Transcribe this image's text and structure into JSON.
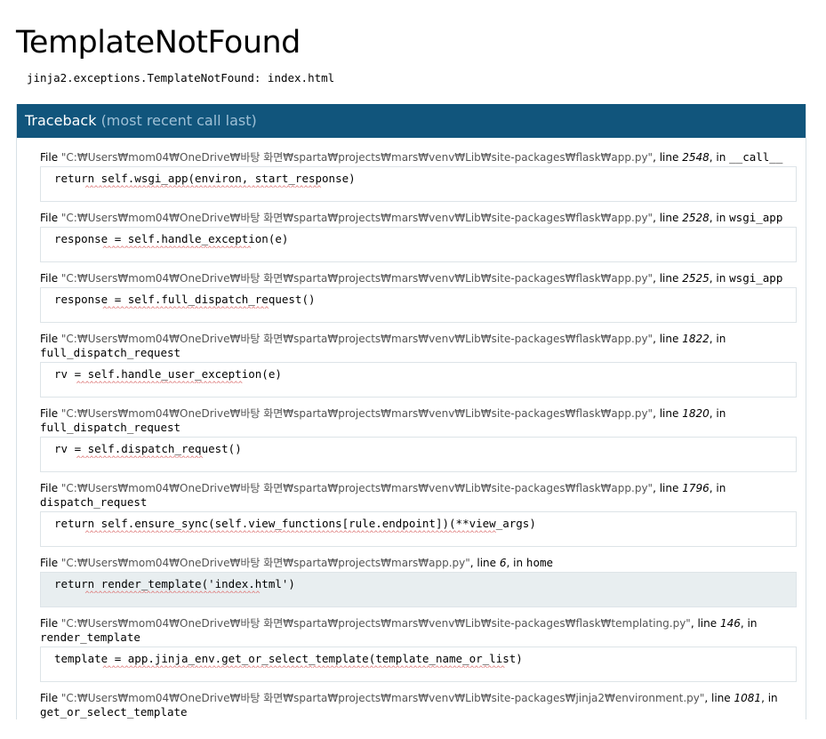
{
  "title": "TemplateNotFound",
  "message": "jinja2.exceptions.TemplateNotFound: index.html",
  "traceback": {
    "label": "Traceback",
    "sub": "(most recent call last)"
  },
  "frames": [
    {
      "file": "\"C:₩Users₩mom04₩OneDrive₩바탕 화면₩sparta₩projects₩mars₩venv₩Lib₩site-packages₩flask₩app.py\"",
      "line": "2548",
      "func": "__call__",
      "code": "return self.wsgi_app(environ, start_response)",
      "caret": "^^^^^^^^^^^^^^^^^^^^^^^^^^^^^^^^^^^^^^^^^^^^^^^^^^^^^^",
      "caret_indent": "       "
    },
    {
      "file": "\"C:₩Users₩mom04₩OneDrive₩바탕 화면₩sparta₩projects₩mars₩venv₩Lib₩site-packages₩flask₩app.py\"",
      "line": "2528",
      "func": "wsgi_app",
      "code": "response = self.handle_exception(e)",
      "caret": "^^^^^^^^^^^^^^^^^^^^^^^^^^^^^^^^^^",
      "caret_indent": "           "
    },
    {
      "file": "\"C:₩Users₩mom04₩OneDrive₩바탕 화면₩sparta₩projects₩mars₩venv₩Lib₩site-packages₩flask₩app.py\"",
      "line": "2525",
      "func": "wsgi_app",
      "code": "response = self.full_dispatch_request()",
      "caret": "^^^^^^^^^^^^^^^^^^^^^^^^^^^^^^^^^^^^^^",
      "caret_indent": "           "
    },
    {
      "file": "\"C:₩Users₩mom04₩OneDrive₩바탕 화면₩sparta₩projects₩mars₩venv₩Lib₩site-packages₩flask₩app.py\"",
      "line": "1822",
      "func": "full_dispatch_request",
      "code": "rv = self.handle_user_exception(e)",
      "caret": "^^^^^^^^^^^^^^^^^^^^^^^^^^^^^^^^^^^^^^",
      "caret_indent": "     "
    },
    {
      "file": "\"C:₩Users₩mom04₩OneDrive₩바탕 화면₩sparta₩projects₩mars₩venv₩Lib₩site-packages₩flask₩app.py\"",
      "line": "1820",
      "func": "full_dispatch_request",
      "code": "rv = self.dispatch_request()",
      "caret": "^^^^^^^^^^^^^^^^^^^^^^^^^^^^^",
      "caret_indent": "     "
    },
    {
      "file": "\"C:₩Users₩mom04₩OneDrive₩바탕 화면₩sparta₩projects₩mars₩venv₩Lib₩site-packages₩flask₩app.py\"",
      "line": "1796",
      "func": "dispatch_request",
      "code": "return self.ensure_sync(self.view_functions[rule.endpoint])(**view_args)",
      "caret": "^^^^^^^^^^^^^^^^^^^^^^^^^^^^^^^^^^^^^^^^^^^^^^^^^^^^^^^^^^^^^^^^^^^^^^^^^^^^^^^^^^^^^^^^^^^^^^",
      "caret_indent": "       "
    },
    {
      "file": "\"C:₩Users₩mom04₩OneDrive₩바탕 화면₩sparta₩projects₩mars₩app.py\"",
      "line": "6",
      "func": "home",
      "code": "return render_template('index.html')",
      "caret": "^^^^^^^^^^^^^^^^^^^^^^^^^^^^^^^^^^^^^^^^",
      "caret_indent": "       ",
      "current": true
    },
    {
      "file": "\"C:₩Users₩mom04₩OneDrive₩바탕 화면₩sparta₩projects₩mars₩venv₩Lib₩site-packages₩flask₩templating.py\"",
      "line": "146",
      "func": "render_template",
      "code": "template = app.jinja_env.get_or_select_template(template_name_or_list)",
      "caret": "^^^^^^^^^^^^^^^^^^^^^^^^^^^^^^^^^^^^^^^^^^^^^^^^^^^^^^^^^^^^^^^^^^^^^^^^^^^^^^^^^^^^^^^^^^^^",
      "caret_indent": "           "
    },
    {
      "file": "\"C:₩Users₩mom04₩OneDrive₩바탕 화면₩sparta₩projects₩mars₩venv₩Lib₩site-packages₩jinja2₩environment.py\"",
      "line": "1081",
      "func": "get_or_select_template",
      "code": "",
      "caret": "",
      "caret_indent": ""
    }
  ],
  "labels": {
    "file": "File",
    "line": "line",
    "in": "in"
  }
}
